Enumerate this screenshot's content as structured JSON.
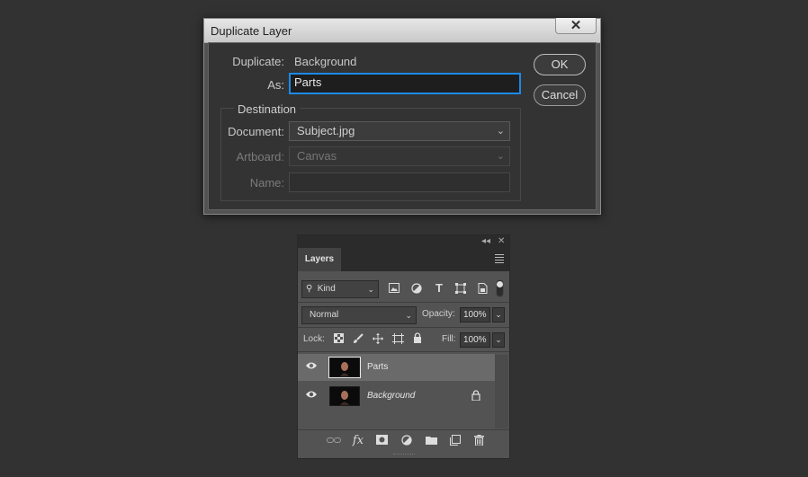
{
  "dialog": {
    "title": "Duplicate Layer",
    "close_glyph": "✕",
    "duplicate_label": "Duplicate:",
    "duplicate_value": "Background",
    "as_label": "As:",
    "as_value": "Parts",
    "destination_title": "Destination",
    "document_label": "Document:",
    "document_value": "Subject.jpg",
    "artboard_label": "Artboard:",
    "artboard_value": "Canvas",
    "name_label": "Name:",
    "name_value": "",
    "ok_label": "OK",
    "cancel_label": "Cancel"
  },
  "layers_panel": {
    "collapse_glyph": "◂◂",
    "close_glyph": "✕",
    "tab_label": "Layers",
    "filter_kind": "Kind",
    "filter_icons": [
      "image-filter-icon",
      "adjustment-filter-icon",
      "type-filter-icon",
      "shape-filter-icon",
      "smart-object-filter-icon"
    ],
    "blend_mode": "Normal",
    "opacity_label": "Opacity:",
    "opacity_value": "100%",
    "lock_label": "Lock:",
    "lock_icons": [
      "lock-transparent-icon",
      "lock-paint-icon",
      "lock-position-icon",
      "lock-artboard-icon",
      "lock-all-icon"
    ],
    "fill_label": "Fill:",
    "fill_value": "100%",
    "layers": [
      {
        "name": "Parts",
        "selected": true,
        "visible": true,
        "locked": false
      },
      {
        "name": "Background",
        "selected": false,
        "visible": true,
        "locked": true
      }
    ],
    "footer_icons": [
      "link-layers-icon",
      "fx-icon",
      "add-mask-icon",
      "adjustment-layer-icon",
      "group-folder-icon",
      "new-layer-icon",
      "trash-icon"
    ],
    "fx_label": "fx"
  },
  "colors": {
    "background": "#323232",
    "accent_focus": "#1b8ae8",
    "panel": "#535353",
    "selected_row": "#6a6a6a"
  }
}
